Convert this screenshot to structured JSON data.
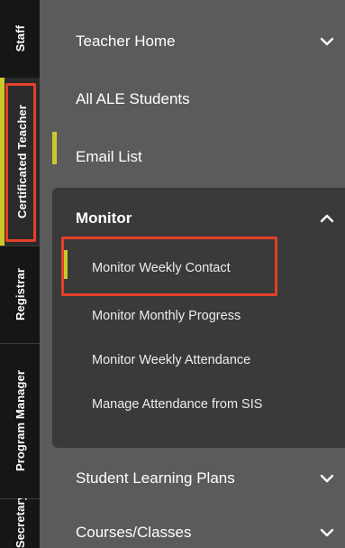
{
  "rail": {
    "tabs": [
      {
        "label": "Staff"
      },
      {
        "label": "Certificated Teacher",
        "active": true
      },
      {
        "label": "Registrar"
      },
      {
        "label": "Program Manager"
      },
      {
        "label": "Secretary"
      }
    ]
  },
  "menu": {
    "items": [
      {
        "label": "Teacher Home",
        "icon": "chevron-down-icon"
      },
      {
        "label": "All ALE Students"
      },
      {
        "label": "Email List",
        "selected": true
      },
      {
        "label": "Student Learning Plans",
        "icon": "chevron-down-icon"
      },
      {
        "label": "Courses/Classes",
        "icon": "chevron-down-icon"
      }
    ],
    "monitor": {
      "label": "Monitor",
      "icon": "chevron-up-icon",
      "expanded": true,
      "subitems": [
        {
          "label": "Monitor Weekly Contact",
          "selected": true
        },
        {
          "label": "Monitor Monthly Progress"
        },
        {
          "label": "Monitor Weekly Attendance"
        },
        {
          "label": "Manage Attendance from SIS"
        }
      ]
    }
  },
  "colors": {
    "rail_bg": "#161616",
    "menu_bg": "#5b5b5b",
    "panel_bg": "#3a3a3a",
    "selection_marker": "#c9c92b",
    "annotation_box": "#e3402b"
  }
}
